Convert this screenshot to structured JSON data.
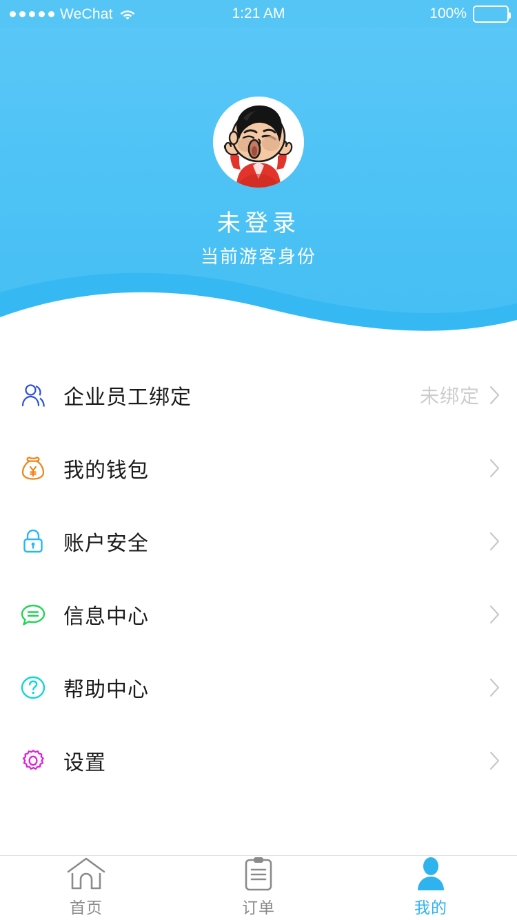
{
  "status_bar": {
    "carrier": "WeChat",
    "signal_dots": 5,
    "wifi_icon": "wifi-icon",
    "time": "1:21 AM",
    "battery_percent": "100%",
    "battery_level": 100
  },
  "header": {
    "avatar_icon": "avatar-cartoon-boy",
    "name": "未登录",
    "subtitle": "当前游客身份",
    "background_color": "#4DC2F5",
    "wave_color_top": "#5BC8F7",
    "wave_color_mid": "#36B9F2",
    "wave_color_bottom": "#ffffff"
  },
  "menu": {
    "items": [
      {
        "icon": "person-outline-icon",
        "icon_color": "#2B4FE0",
        "label": "企业员工绑定",
        "value": "未绑定",
        "chevron": "chevron-right-icon"
      },
      {
        "icon": "money-bag-icon",
        "icon_color": "#F08214",
        "label": "我的钱包",
        "value": "",
        "chevron": "chevron-right-icon"
      },
      {
        "icon": "lock-icon",
        "icon_color": "#28B7F2",
        "label": "账户安全",
        "value": "",
        "chevron": "chevron-right-icon"
      },
      {
        "icon": "message-bubble-icon",
        "icon_color": "#1FD655",
        "label": "信息中心",
        "value": "",
        "chevron": "chevron-right-icon"
      },
      {
        "icon": "question-circle-icon",
        "icon_color": "#13D4D4",
        "label": "帮助中心",
        "value": "",
        "chevron": "chevron-right-icon"
      },
      {
        "icon": "gear-icon",
        "icon_color": "#DD22DD",
        "label": "设置",
        "value": "",
        "chevron": "chevron-right-icon"
      }
    ]
  },
  "tabbar": {
    "active_color": "#2FB3EF",
    "inactive_color": "#8a8a8a",
    "tabs": [
      {
        "icon": "home-icon",
        "label": "首页",
        "active": false
      },
      {
        "icon": "clipboard-orders-icon",
        "label": "订单",
        "active": false
      },
      {
        "icon": "person-filled-icon",
        "label": "我的",
        "active": true
      }
    ]
  }
}
